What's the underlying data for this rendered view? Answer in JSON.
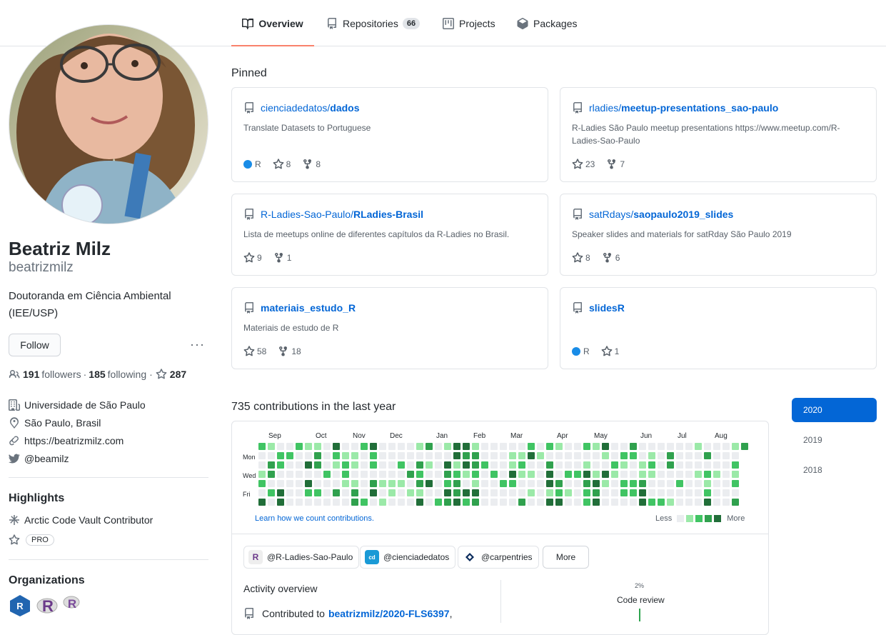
{
  "nav": {
    "tabs": [
      {
        "label": "Overview",
        "icon": "book-icon",
        "active": true
      },
      {
        "label": "Repositories",
        "icon": "repo-icon",
        "count": "66"
      },
      {
        "label": "Projects",
        "icon": "project-icon"
      },
      {
        "label": "Packages",
        "icon": "package-icon"
      }
    ]
  },
  "profile": {
    "name": "Beatriz Milz",
    "login": "beatrizmilz",
    "bio": "Doutoranda em Ciência Ambiental (IEE/USP)",
    "follow_label": "Follow",
    "more_label": "···",
    "followers_count": "191",
    "followers_label": "followers",
    "following_count": "185",
    "following_label": "following",
    "dot_sep": "·",
    "stars_count": "287",
    "organization": "Universidade de São Paulo",
    "location": "São Paulo, Brasil",
    "website": "https://beatrizmilz.com",
    "twitter": "@beamilz"
  },
  "highlights": {
    "title": "Highlights",
    "items": [
      "Arctic Code Vault Contributor"
    ],
    "pro_label": "PRO"
  },
  "organizations": {
    "title": "Organizations"
  },
  "pinned": {
    "title": "Pinned",
    "repos": [
      {
        "owner": "cienciadedatos/",
        "name": "dados",
        "desc": "Translate Datasets to Portuguese",
        "lang": "R",
        "stars": "8",
        "forks": "8"
      },
      {
        "owner": "rladies/",
        "name": "meetup-presentations_sao-paulo",
        "desc": "R-Ladies São Paulo meetup presentations https://www.meetup.com/R-Ladies-Sao-Paulo",
        "lang": "",
        "stars": "23",
        "forks": "7"
      },
      {
        "owner": "R-Ladies-Sao-Paulo/",
        "name": "RLadies-Brasil",
        "desc": "Lista de meetups online de diferentes capítulos da R-Ladies no Brasil.",
        "lang": "",
        "stars": "9",
        "forks": "1"
      },
      {
        "owner": "satRdays/",
        "name": "saopaulo2019_slides",
        "desc": "Speaker slides and materials for satRday São Paulo 2019",
        "lang": "",
        "stars": "8",
        "forks": "6"
      },
      {
        "owner": "",
        "name": "materiais_estudo_R",
        "desc": "Materiais de estudo de R",
        "lang": "",
        "stars": "58",
        "forks": "18"
      },
      {
        "owner": "",
        "name": "slidesR",
        "desc": "",
        "lang": "R",
        "stars": "1",
        "forks": ""
      }
    ]
  },
  "contributions": {
    "title": "735 contributions in the last year",
    "months": [
      "Sep",
      "Oct",
      "Nov",
      "Dec",
      "Jan",
      "Feb",
      "Mar",
      "Apr",
      "May",
      "Jun",
      "Jul",
      "Aug"
    ],
    "days": [
      "Mon",
      "Wed",
      "Fri"
    ],
    "learn_link": "Learn how we count contributions.",
    "less_label": "Less",
    "more_label": "More",
    "colors": [
      "#ebedf0",
      "#9be9a8",
      "#40c463",
      "#30a14e",
      "#216e39"
    ],
    "orgs": [
      {
        "label": "@R-Ladies-Sao-Paulo"
      },
      {
        "label": "@cienciadedatos"
      },
      {
        "label": "@carpentries"
      }
    ],
    "org_more": "More",
    "activity_title": "Activity overview",
    "activity_prefix": "Contributed to",
    "activity_repo": "beatrizmilz/2020-FLS6397",
    "activity_suffix": ",",
    "code_review_pct": "2%",
    "code_review_label": "Code review"
  },
  "years": [
    "2020",
    "2019",
    "2018"
  ]
}
